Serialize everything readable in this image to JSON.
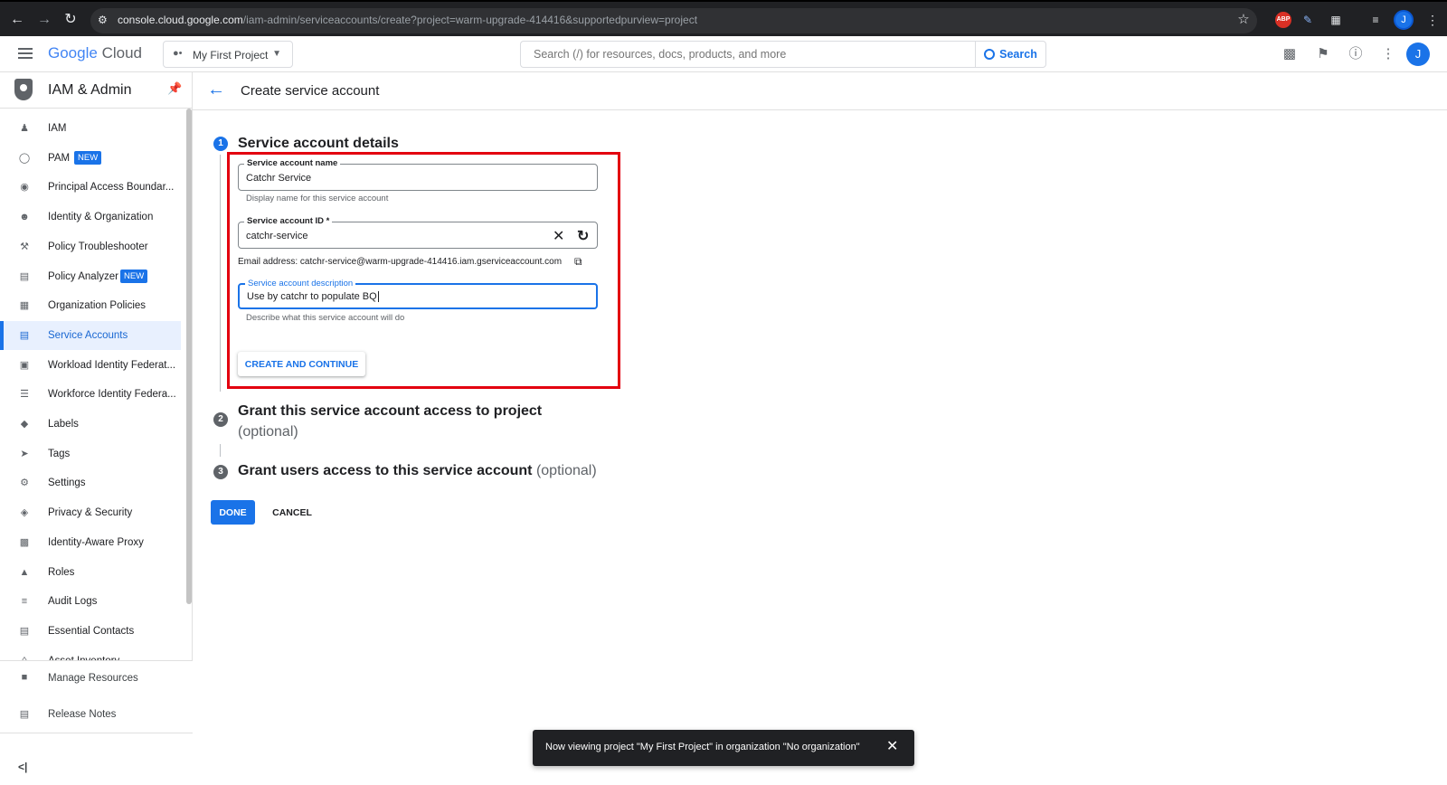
{
  "browser": {
    "url_host": "console.cloud.google.com",
    "url_path": "/iam-admin/serviceaccounts/create?project=warm-upgrade-414416&supportedpurview=project",
    "abp_label": "ABP",
    "avatar_initial": "J"
  },
  "header": {
    "logo_google": "Google",
    "logo_cloud": "Cloud",
    "project_name": "My First Project",
    "search_placeholder": "Search (/) for resources, docs, products, and more",
    "search_button": "Search",
    "avatar_initial": "J"
  },
  "sidebar": {
    "title": "IAM & Admin",
    "items": [
      {
        "label": "IAM",
        "icon": "person-add-icon"
      },
      {
        "label": "PAM",
        "icon": "shield-icon",
        "badge": "NEW"
      },
      {
        "label": "Principal Access Boundar...",
        "icon": "boundary-icon"
      },
      {
        "label": "Identity & Organization",
        "icon": "account-circle-icon"
      },
      {
        "label": "Policy Troubleshooter",
        "icon": "wrench-icon"
      },
      {
        "label": "Policy Analyzer",
        "icon": "document-search-icon",
        "badge": "NEW"
      },
      {
        "label": "Organization Policies",
        "icon": "list-box-icon"
      },
      {
        "label": "Service Accounts",
        "icon": "service-account-icon",
        "active": true
      },
      {
        "label": "Workload Identity Federat...",
        "icon": "id-card-icon"
      },
      {
        "label": "Workforce Identity Federa...",
        "icon": "list-icon"
      },
      {
        "label": "Labels",
        "icon": "tag-icon"
      },
      {
        "label": "Tags",
        "icon": "chevron-tag-icon"
      },
      {
        "label": "Settings",
        "icon": "gear-icon"
      },
      {
        "label": "Privacy & Security",
        "icon": "shield-lock-icon"
      },
      {
        "label": "Identity-Aware Proxy",
        "icon": "proxy-icon"
      },
      {
        "label": "Roles",
        "icon": "roles-icon"
      },
      {
        "label": "Audit Logs",
        "icon": "lines-icon"
      },
      {
        "label": "Essential Contacts",
        "icon": "contact-card-icon"
      },
      {
        "label": "Asset Inventory",
        "icon": "inventory-icon"
      }
    ],
    "bottom": {
      "manage_resources": "Manage Resources",
      "release_notes": "Release Notes"
    }
  },
  "page": {
    "title": "Create service account",
    "step1": {
      "number": "1",
      "title": "Service account details"
    },
    "step2": {
      "number": "2",
      "title": "Grant this service account access to project",
      "optional": "(optional)"
    },
    "step3": {
      "number": "3",
      "title": "Grant users access to this service account",
      "optional": "(optional)"
    },
    "form": {
      "name_label": "Service account name",
      "name_value": "Catchr Service",
      "name_hint": "Display name for this service account",
      "id_label": "Service account ID *",
      "id_value": "catchr-service",
      "email_text": "Email address: catchr-service@warm-upgrade-414416.iam.gserviceaccount.com",
      "desc_label": "Service account description",
      "desc_value": "Use by catchr to populate BQ",
      "desc_hint": "Describe what this service account will do",
      "create_continue": "CREATE AND CONTINUE"
    },
    "done": "DONE",
    "cancel": "CANCEL"
  },
  "snackbar": {
    "text": "Now viewing project \"My First Project\" in organization \"No organization\""
  },
  "colors": {
    "accent": "#1a73e8",
    "highlight": "#e3000f",
    "snackbar_bg": "#202124"
  }
}
